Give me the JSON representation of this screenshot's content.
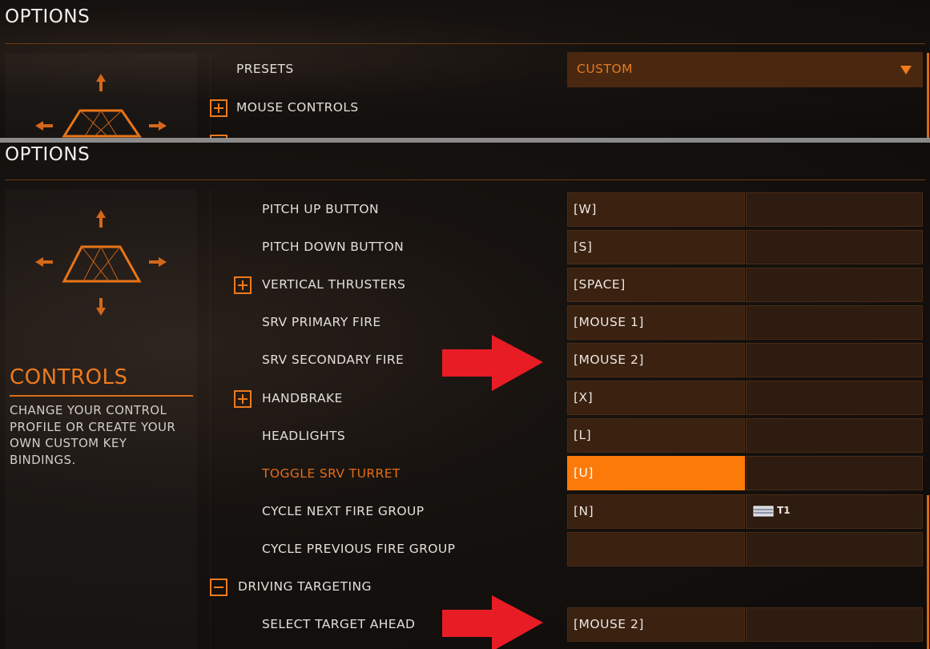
{
  "window": {
    "title": "OPTIONS"
  },
  "top_panel": {
    "presets_label": "PRESETS",
    "presets_value": "CUSTOM",
    "mouse_controls_label": "MOUSE CONTROLS"
  },
  "sidebar": {
    "heading": "CONTROLS",
    "description": "CHANGE YOUR CONTROL PROFILE OR CREATE YOUR OWN CUSTOM KEY BINDINGS."
  },
  "bindings": [
    {
      "label": "PITCH UP BUTTON",
      "primary": "[W]",
      "secondary": ""
    },
    {
      "label": "PITCH DOWN BUTTON",
      "primary": "[S]",
      "secondary": ""
    },
    {
      "label": "VERTICAL THRUSTERS",
      "primary": "[SPACE]",
      "secondary": ""
    },
    {
      "label": "SRV PRIMARY FIRE",
      "primary": "[MOUSE 1]",
      "secondary": ""
    },
    {
      "label": "SRV SECONDARY FIRE",
      "primary": "[MOUSE 2]",
      "secondary": ""
    },
    {
      "label": "HANDBRAKE",
      "primary": "[X]",
      "secondary": ""
    },
    {
      "label": "HEADLIGHTS",
      "primary": "[L]",
      "secondary": ""
    },
    {
      "label": "TOGGLE SRV TURRET",
      "primary": "[U]",
      "secondary": ""
    },
    {
      "label": "CYCLE NEXT FIRE GROUP",
      "primary": "[N]",
      "secondary": "T1"
    },
    {
      "label": "CYCLE PREVIOUS FIRE GROUP",
      "primary": "",
      "secondary": ""
    }
  ],
  "section": {
    "label": "DRIVING TARGETING"
  },
  "target_binding": {
    "label": "SELECT TARGET AHEAD",
    "primary": "[MOUSE 2]",
    "secondary": ""
  },
  "colors": {
    "accent": "#ee7a1c",
    "selected": "#fb7a0a",
    "bind_bg": "#3a2110",
    "annotation_arrow": "#e81c24"
  }
}
